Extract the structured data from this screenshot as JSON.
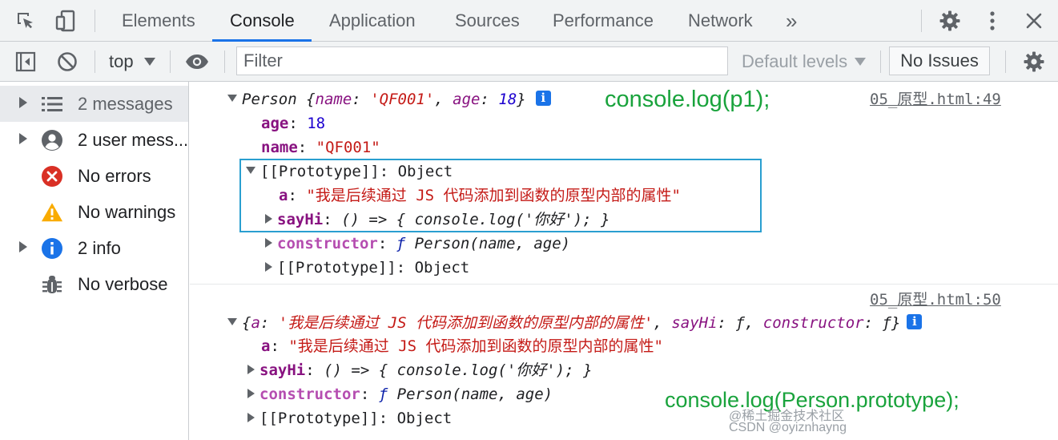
{
  "tabs": {
    "elements": "Elements",
    "console": "Console",
    "application": "Application",
    "sources": "Sources",
    "performance": "Performance",
    "network": "Network",
    "more": "»"
  },
  "toolbar": {
    "context": "top",
    "filter_placeholder": "Filter",
    "levels": "Default levels",
    "issues": "No Issues"
  },
  "sidebar": {
    "items": [
      {
        "label": "2 messages"
      },
      {
        "label": "2 user mess..."
      },
      {
        "label": "No errors"
      },
      {
        "label": "No warnings"
      },
      {
        "label": "2 info"
      },
      {
        "label": "No verbose"
      }
    ]
  },
  "console": {
    "msg1": {
      "class_name": "Person",
      "summary_open": " {",
      "k_name": "name",
      "v_name": "'QF001'",
      "k_age": "age",
      "v_age": "18",
      "summary_close": "}",
      "source": "05_原型.html:49",
      "age_key": "age",
      "age_val": "18",
      "name_key": "name",
      "name_val": "\"QF001\"",
      "proto_key": "[[Prototype]]",
      "proto_val": "Object",
      "a_key": "a",
      "a_val": "\"我是后续通过 JS 代码添加到函数的原型内部的属性\"",
      "sayhi_key": "sayHi",
      "sayhi_val": "() => { console.log('你好'); }",
      "ctor_key": "constructor",
      "ctor_f": "ƒ",
      "ctor_val": "Person(name, age)",
      "proto2_key": "[[Prototype]]",
      "proto2_val": "Object"
    },
    "msg2": {
      "source": "05_原型.html:50",
      "s_open": "{",
      "s_a_key": "a",
      "s_a_val": "'我是后续通过 JS 代码添加到函数的原型内部的属性'",
      "s_sayhi_key": "sayHi",
      "s_sayhi_val": "ƒ",
      "s_ctor_key": "constructor",
      "s_ctor_val": "ƒ",
      "s_close": "}",
      "a_key": "a",
      "a_val": "\"我是后续通过 JS 代码添加到函数的原型内部的属性\"",
      "sayhi_key": "sayHi",
      "sayhi_val": "() => { console.log('你好'); }",
      "ctor_key": "constructor",
      "ctor_f": "ƒ",
      "ctor_val": "Person(name, age)",
      "proto_key": "[[Prototype]]",
      "proto_val": "Object"
    }
  },
  "annotations": {
    "a1": "console.log(p1);",
    "a2": "console.log(Person.prototype);"
  },
  "watermark": "@稀土掘金技术社区\nCSDN @oyiznhayng",
  "colors": {
    "accent": "#1a73e8",
    "error": "#d93025",
    "warning": "#f9ab00",
    "annotation": "#19a33c",
    "highlight_box": "#2a9fd0"
  }
}
